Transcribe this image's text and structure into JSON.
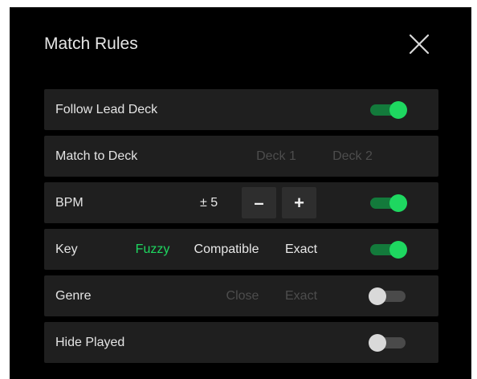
{
  "dialog": {
    "title": "Match Rules",
    "close_icon": "close-icon"
  },
  "colors": {
    "accent": "#1ed760",
    "panel_bg": "#000000",
    "row_bg": "#1f1f1f",
    "dim_text": "#4d4d4d"
  },
  "rows": {
    "follow_lead_deck": {
      "label": "Follow Lead Deck",
      "enabled": true
    },
    "match_to_deck": {
      "label": "Match to Deck",
      "options": [
        "Deck 1",
        "Deck 2"
      ]
    },
    "bpm": {
      "label": "BPM",
      "value": "± 5",
      "decrement_label": "–",
      "increment_label": "+",
      "enabled": true
    },
    "key": {
      "label": "Key",
      "options": [
        "Fuzzy",
        "Compatible",
        "Exact"
      ],
      "selected": "Fuzzy",
      "enabled": true
    },
    "genre": {
      "label": "Genre",
      "options": [
        "Close",
        "Exact"
      ],
      "enabled": false
    },
    "hide_played": {
      "label": "Hide Played",
      "enabled": false
    }
  }
}
